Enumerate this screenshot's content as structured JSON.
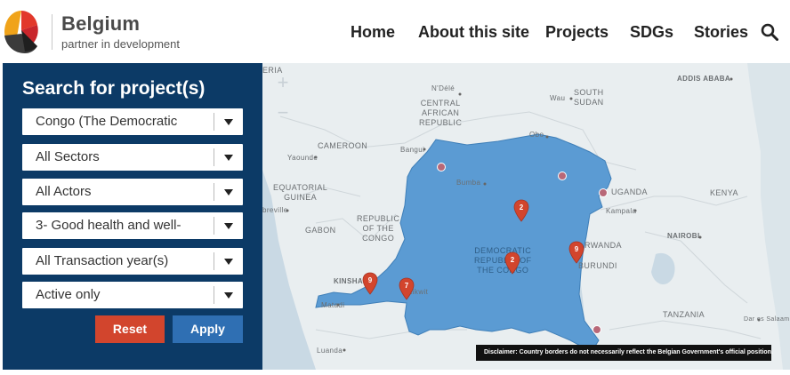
{
  "brand": {
    "name": "Belgium",
    "tagline": "partner in development"
  },
  "nav": {
    "items": [
      "Home",
      "About this site",
      "Projects",
      "SDGs",
      "Stories"
    ]
  },
  "search": {
    "title": "Search for project(s)",
    "filters": [
      "Congo (The Democratic",
      "All Sectors",
      "All Actors",
      "3- Good health and well-",
      "All Transaction year(s)",
      "Active only"
    ],
    "reset_label": "Reset",
    "apply_label": "Apply"
  },
  "map": {
    "zoom_in": "+",
    "zoom_out": "−",
    "labels": {
      "eria": "ERIA",
      "ndele": "N'Délé",
      "car": "CENTRAL\nAFRICAN\nREPUBLIC",
      "wau": "Wau",
      "south_sudan": "SOUTH\nSUDAN",
      "addis": "ADDIS ABABA",
      "cameroon": "CAMEROON",
      "bangui": "Bangui",
      "obo": "Obo",
      "yaounde": "Yaounde",
      "bumba": "Bumba",
      "eq_guinea": "EQUATORIAL\nGUINEA",
      "uganda": "UGANDA",
      "kenya": "KENYA",
      "kampala": "Kampala",
      "libreville": "breville",
      "roc": "REPUBLIC\nOF THE\nCONGO",
      "gabon": "GABON",
      "drc": "DEMOCRATIC\nREPUBLIC OF\nTHE CONGO",
      "rwanda": "RWANDA",
      "nairobi": "NAIROBI",
      "burundi": "BURUNDI",
      "kinshasa": "KINSHA",
      "kikwit": "Kikwit",
      "matadi": "Matadi",
      "tanzania": "TANZANIA",
      "dar": "Dar es Salaam",
      "luanda": "Luanda"
    },
    "markers": [
      {
        "count": "2"
      },
      {
        "count": "2"
      },
      {
        "count": "9"
      },
      {
        "count": "9"
      },
      {
        "count": "7"
      }
    ],
    "disclaimer": "Disclaimer: Country borders do not necessarily reflect the Belgian Government's official position.",
    "colors": {
      "country_fill": "#5b9bd3",
      "marker": "#d2452d",
      "water": "#c9d9e4"
    }
  }
}
